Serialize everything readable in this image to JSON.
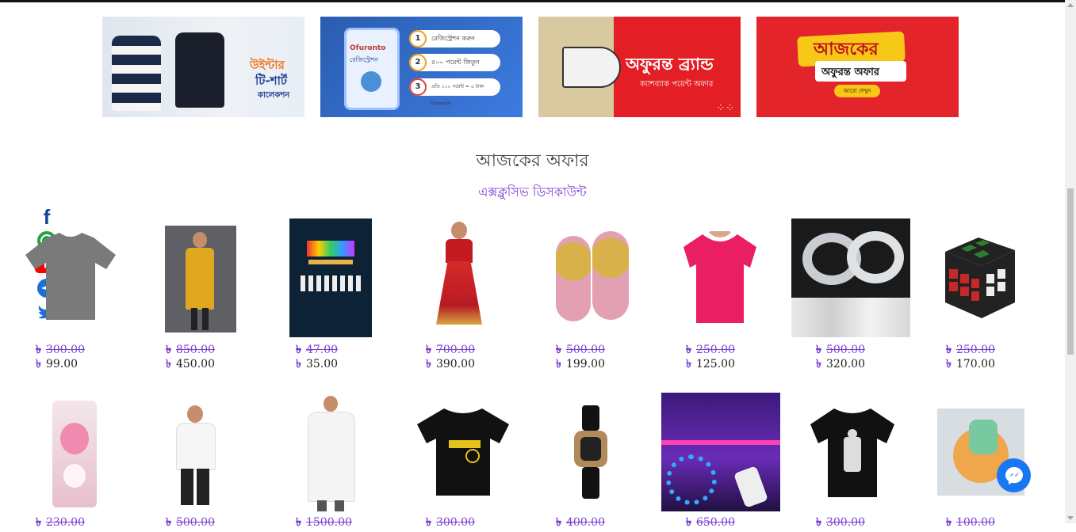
{
  "banners": [
    {
      "name": "winter-tshirt-banner",
      "lines": [
        "উইন্টার",
        "টি-শার্ট",
        "কালেকশন"
      ]
    },
    {
      "name": "registration-banner",
      "brand": "Ofuronto",
      "sub": "রেজিস্ট্রেশন",
      "steps": [
        {
          "n": "1",
          "t": "রেজিস্ট্রেশন করুন"
        },
        {
          "n": "2",
          "t": "৫০০ পয়েন্ট জিতুন"
        },
        {
          "n": "3",
          "t": "প্রতি ১০০ পয়েন্ট = ৫ টাকা ডিসকাউন্ট"
        }
      ]
    },
    {
      "name": "brand-cashback-banner",
      "lines": [
        "অফুরন্ত ব্র্যান্ড",
        "ক্যাশব্যাক পয়েন্ট অফার"
      ]
    },
    {
      "name": "todays-offer-banner",
      "lines": [
        "আজকের",
        "অফুরন্ত অফার",
        "আরো দেখুন"
      ]
    }
  ],
  "section": {
    "title": "আজকের অফার",
    "subtitle": "এক্সক্লুসিভ ডিসকাউন্ট"
  },
  "currency": "৳",
  "social": [
    "facebook-icon",
    "whatsapp-icon",
    "youtube-icon",
    "telegram-icon",
    "twitter-icon"
  ],
  "row1": [
    {
      "old": "300.00",
      "new": "99.00",
      "item": "grey-tshirt"
    },
    {
      "old": "850.00",
      "new": "450.00",
      "item": "yellow-kurti"
    },
    {
      "old": "47.00",
      "new": "35.00",
      "item": "music-book"
    },
    {
      "old": "700.00",
      "new": "390.00",
      "item": "girl-dress"
    },
    {
      "old": "500.00",
      "new": "199.00",
      "item": "pink-loafer"
    },
    {
      "old": "250.00",
      "new": "125.00",
      "item": "pink-tshirt"
    },
    {
      "old": "500.00",
      "new": "320.00",
      "item": "nano-tape"
    },
    {
      "old": "250.00",
      "new": "170.00",
      "item": "rubiks-cube"
    }
  ],
  "row2": [
    {
      "old": "230.00",
      "item": "pink-bottle"
    },
    {
      "old": "500.00",
      "item": "white-polo"
    },
    {
      "old": "1500.00",
      "item": "white-panjabi"
    },
    {
      "old": "300.00",
      "item": "black-tshirt-print"
    },
    {
      "old": "400.00",
      "item": "sport-watch"
    },
    {
      "old": "650.00",
      "item": "led-strip"
    },
    {
      "old": "300.00",
      "item": "black-tshirt-graphic"
    },
    {
      "old": "100.00",
      "item": "dish-brush"
    }
  ],
  "colors": {
    "accent": "#7b3fd1",
    "messenger": "#1877f2",
    "banner_red": "#e31e24"
  }
}
